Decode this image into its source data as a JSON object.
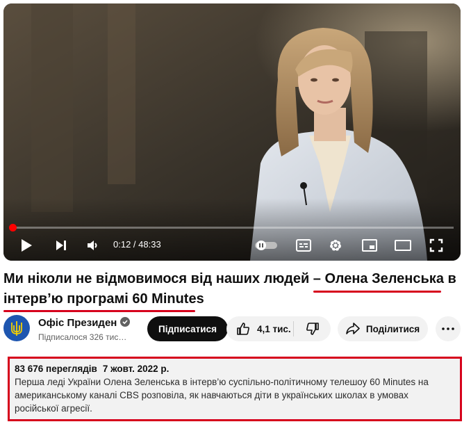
{
  "player": {
    "time": "0:12 / 48:33",
    "progress": 0.004,
    "icons": [
      "play-icon",
      "next-icon",
      "volume-icon",
      "autoplay-toggle-icon",
      "subtitles-icon",
      "settings-icon",
      "miniplayer-icon",
      "theater-icon",
      "fullscreen-icon"
    ]
  },
  "video": {
    "title_part1": "Ми ніколи не відмовимося від наших людей – Олена Зеленська в",
    "title_part2": "інтерв’ю програмі 60 Minutes"
  },
  "channel": {
    "name": "Офіс Президен",
    "subscribers": "Підписалося 326 тис…",
    "subscribe_label": "Підписатися"
  },
  "actions": {
    "likes": "4,1 тис.",
    "share_label": "Поділитися"
  },
  "description": {
    "views": "83 676 переглядів",
    "date": "7 жовт. 2022 р.",
    "line1": "Перша леді України Олена Зеленська в інтерв’ю суспільно-політичному телешоу 60 Minutes на",
    "line2": "американському каналі CBS розповіла, як навчаються діти в українських школах в умовах",
    "line3": "російської агресії."
  },
  "colors": {
    "accent_red": "#d6001c",
    "progress_red": "#ff0000",
    "pill_bg": "#f2f2f2"
  }
}
